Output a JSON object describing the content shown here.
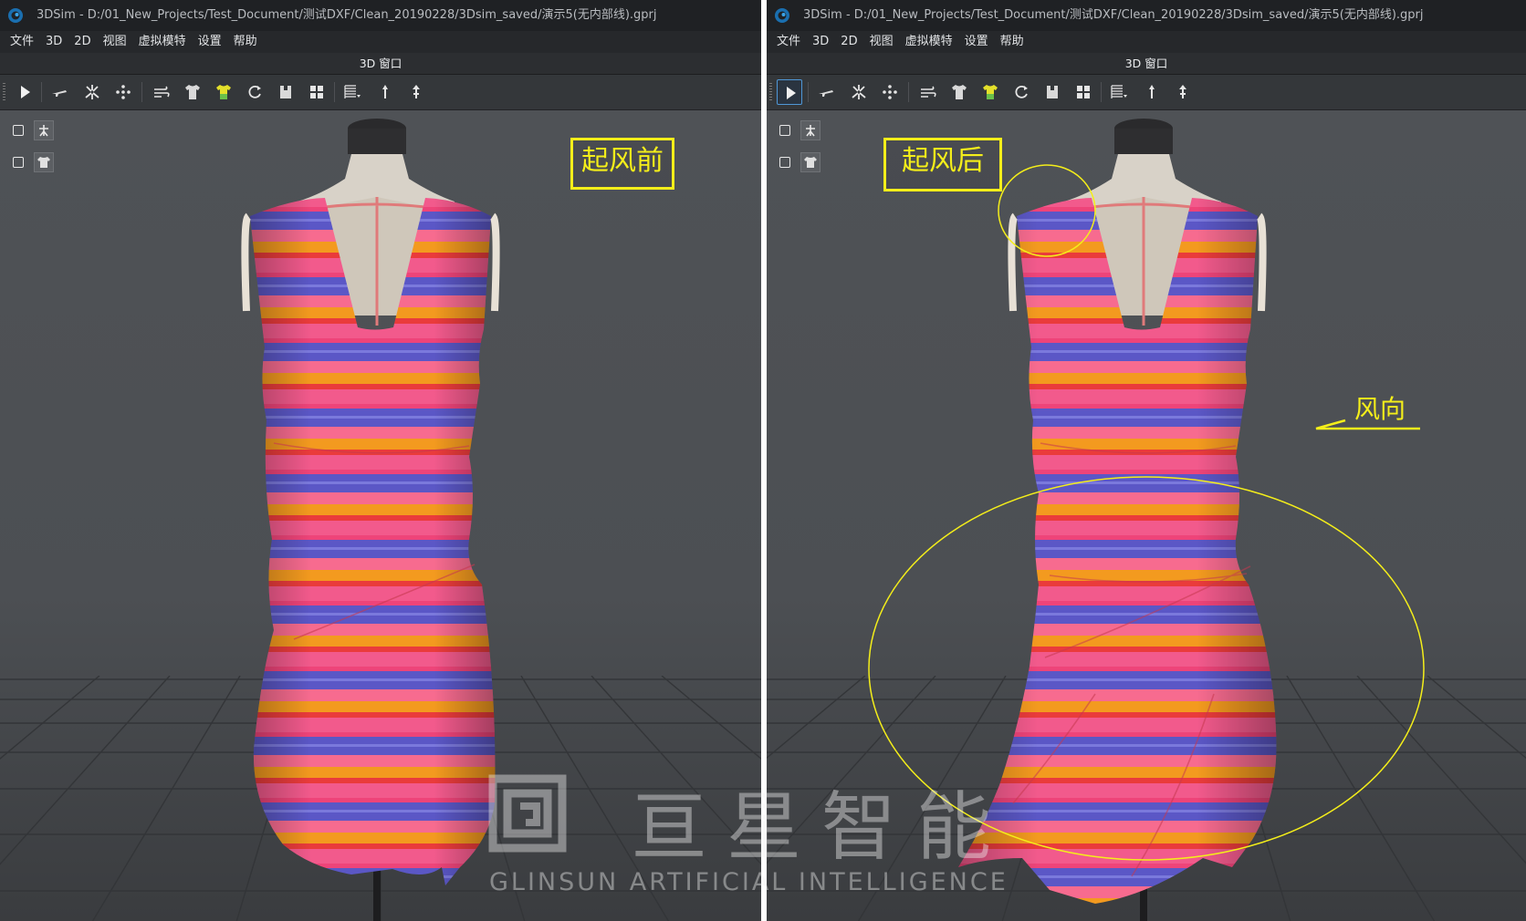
{
  "left_window": {
    "title": "3DSim - D:/01_New_Projects/Test_Document/测试DXF/Clean_20190228/3Dsim_saved/演示5(无内部线).gprj",
    "menu": [
      "文件",
      "3D",
      "2D",
      "视图",
      "虚拟模特",
      "设置",
      "帮助"
    ],
    "view_title": "3D 窗口",
    "annotation_label": "起风前"
  },
  "right_window": {
    "title": "3DSim - D:/01_New_Projects/Test_Document/测试DXF/Clean_20190228/3Dsim_saved/演示5(无内部线).gprj",
    "menu": [
      "文件",
      "3D",
      "2D",
      "视图",
      "虚拟模特",
      "设置",
      "帮助"
    ],
    "view_title": "3D 窗口",
    "annotation_label": "起风后",
    "wind_direction_label": "风向"
  },
  "toolbar_icons": [
    "play-icon",
    "airplane-icon",
    "burst-icon",
    "points-icon",
    "wind-icon",
    "shirt-icon",
    "colored-shirt-icon",
    "refresh-icon",
    "garment-icon",
    "grid-icon",
    "pattern-icon",
    "pin-icon",
    "pin-up-icon"
  ],
  "side_icons": [
    "avatar-icon",
    "garment-icon"
  ],
  "watermark": {
    "chinese": "亘星智能",
    "english": "GLINSUN ARTIFICIAL INTELLIGENCE"
  },
  "colors": {
    "annotation": "#f4ee1a",
    "viewport_bg": "#4d5054",
    "titlebar_bg": "#1f2124",
    "stripe_orange": "#f39a1f",
    "stripe_pink": "#f25a8c",
    "stripe_blue": "#5a57c8",
    "stripe_red": "#ea3b3b"
  }
}
